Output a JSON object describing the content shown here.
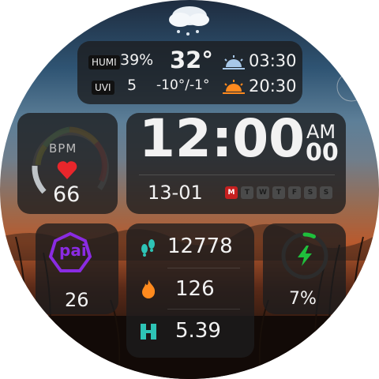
{
  "weather": {
    "humi_label": "HUMI",
    "humidity": "39%",
    "temperature": "32°",
    "sunrise": "03:30",
    "uvi_label": "UVI",
    "uvi": "5",
    "temp_range": "-10°/-1°",
    "sunset": "20:30"
  },
  "heart": {
    "label": "BPM",
    "value": "66"
  },
  "time": {
    "clock": "12:00",
    "ampm": "AM",
    "seconds": "00"
  },
  "date": {
    "text": "13-01",
    "days": [
      "M",
      "T",
      "W",
      "T",
      "F",
      "S",
      "S"
    ],
    "active_index": 0
  },
  "pai": {
    "logo": "pai",
    "value": "26"
  },
  "activity": {
    "steps": "12778",
    "calories": "126",
    "distance": "5.39"
  },
  "battery": {
    "value": "7%",
    "level": 0.07
  },
  "colors": {
    "heart": "#e8262b",
    "pai": "#8a2be2",
    "steps": "#2ec4b6",
    "calories": "#ff8a1e",
    "battery": "#1fbf3c",
    "active_day": "#c62020"
  }
}
